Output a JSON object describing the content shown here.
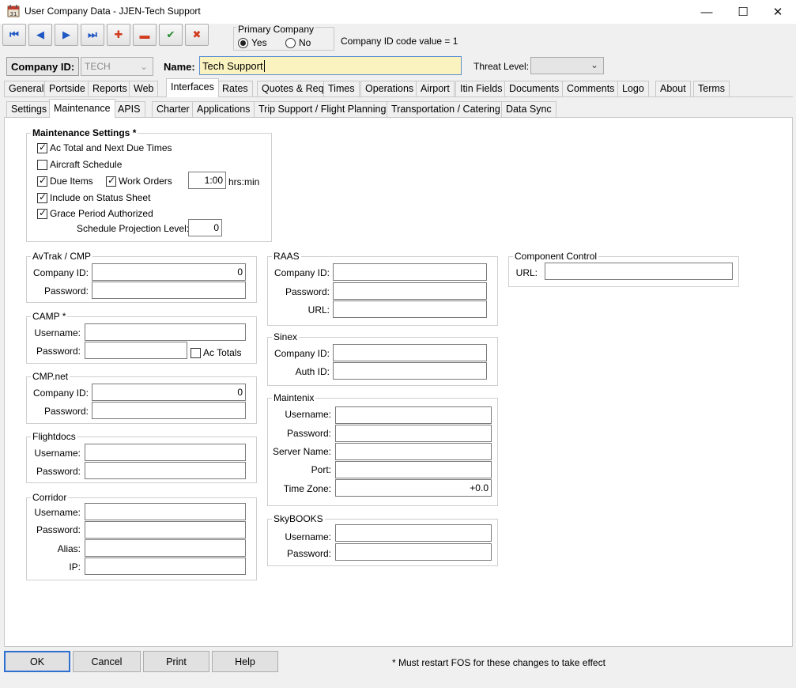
{
  "window": {
    "title": "User Company Data - JJEN-Tech Support"
  },
  "toolbar": {
    "first": "⏮",
    "prev": "◀",
    "next": "▶",
    "last": "⏭",
    "add": "✚",
    "remove": "▬",
    "save": "✔",
    "cancel": "✖"
  },
  "primary_company": {
    "legend": "Primary Company",
    "yes": "Yes",
    "no": "No",
    "selected": "Yes"
  },
  "company_id_info": "Company ID code value = 1",
  "header": {
    "company_id_label": "Company ID:",
    "company_id_value": "TECH",
    "name_label": "Name:",
    "name_value": "Tech Support",
    "threat_label": "Threat Level:",
    "threat_value": ""
  },
  "tabs_top": [
    "General",
    "Portside",
    "Reports",
    "Web",
    "Interfaces",
    "Rates",
    "Quotes & Req",
    "Times",
    "Operations",
    "Airport",
    "Itin Fields",
    "Documents",
    "Comments",
    "Logo",
    "About",
    "Terms"
  ],
  "tabs_sub": [
    "Settings",
    "Maintenance",
    "APIS",
    "Charter",
    "Applications",
    "Trip Support / Flight Planning",
    "Transportation / Catering",
    "Data Sync"
  ],
  "maintenance": {
    "title": "Maintenance Settings *",
    "ac_total": "Ac Total and Next Due Times",
    "aircraft_schedule": "Aircraft Schedule",
    "due_items": "Due Items",
    "work_orders": "Work Orders",
    "time_value": "1:00",
    "time_unit": "hrs:min",
    "status_sheet": "Include on Status Sheet",
    "grace_period": "Grace Period Authorized",
    "projection_label": "Schedule Projection Level:",
    "projection_value": "0"
  },
  "avtrak": {
    "title": "AvTrak / CMP",
    "company_id_label": "Company ID:",
    "company_id_value": "0",
    "password_label": "Password:"
  },
  "camp": {
    "title": "CAMP *",
    "username_label": "Username:",
    "password_label": "Password:",
    "ac_totals": "Ac Totals"
  },
  "cmpnet": {
    "title": "CMP.net",
    "company_id_label": "Company ID:",
    "company_id_value": "0",
    "password_label": "Password:"
  },
  "flightdocs": {
    "title": "Flightdocs",
    "username_label": "Username:",
    "password_label": "Password:"
  },
  "corridor": {
    "title": "Corridor",
    "username_label": "Username:",
    "password_label": "Password:",
    "alias_label": "Alias:",
    "ip_label": "IP:"
  },
  "raas": {
    "title": "RAAS",
    "company_id_label": "Company ID:",
    "password_label": "Password:",
    "url_label": "URL:"
  },
  "sinex": {
    "title": "Sinex",
    "company_id_label": "Company ID:",
    "auth_id_label": "Auth ID:"
  },
  "maintenix": {
    "title": "Maintenix",
    "username_label": "Username:",
    "password_label": "Password:",
    "server_label": "Server Name:",
    "port_label": "Port:",
    "tz_label": "Time Zone:",
    "tz_value": "+0.0"
  },
  "skybooks": {
    "title": "SkyBOOKS",
    "username_label": "Username:",
    "password_label": "Password:"
  },
  "component_control": {
    "title": "Component Control",
    "url_label": "URL:"
  },
  "footer": {
    "ok": "OK",
    "cancel": "Cancel",
    "print": "Print",
    "help": "Help",
    "note": "* Must restart FOS for these changes to take effect"
  }
}
